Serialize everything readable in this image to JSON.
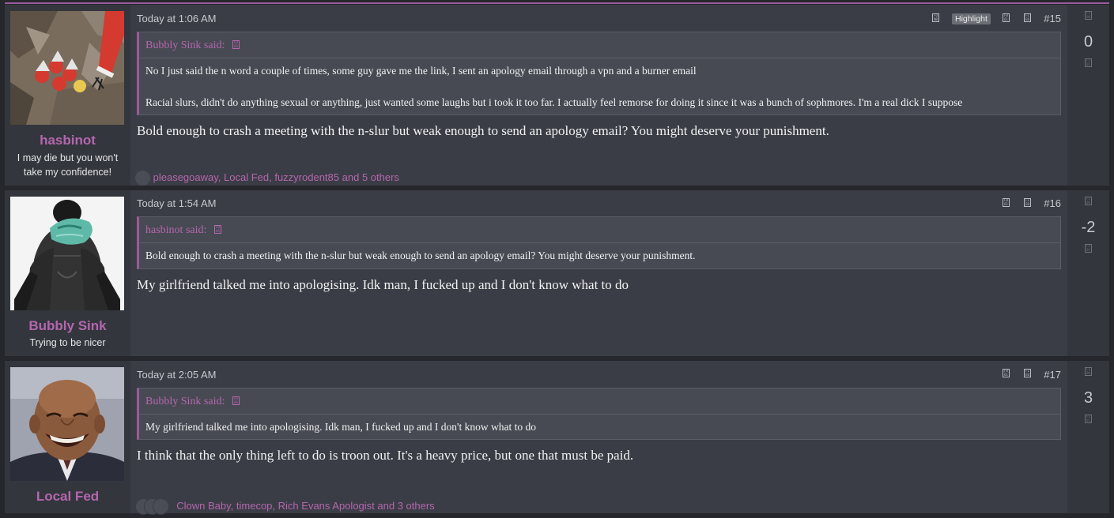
{
  "posts": [
    {
      "user": {
        "name": "hasbinot",
        "title": "I may die but you won't take my confidence!"
      },
      "date": "Today at 1:06 AM",
      "highlight_label": "Highlight",
      "number": "#15",
      "quote": {
        "author": "Bubbly Sink said:",
        "lines": [
          "No I just said the n word a couple of times, some guy gave me the link, I sent an apology email through a vpn and a burner email",
          "Racial slurs, didn't do anything sexual or anything, just wanted some laughs but i took it too far. I actually feel remorse for doing it since it was a bunch of sophmores. I'm a real dick I suppose"
        ]
      },
      "body": "Bold enough to crash a meeting with the n-slur but weak enough to send an apology email? You might deserve your punishment.",
      "reactions": {
        "users": [
          "pleasegoaway",
          "Local Fed",
          "fuzzyrodent85"
        ],
        "more": "and 5 others"
      },
      "score": "0"
    },
    {
      "user": {
        "name": "Bubbly Sink",
        "title": "Trying to be nicer"
      },
      "date": "Today at 1:54 AM",
      "number": "#16",
      "quote": {
        "author": "hasbinot said:",
        "lines": [
          "Bold enough to crash a meeting with the n-slur but weak enough to send an apology email? You might deserve your punishment."
        ]
      },
      "body": "My girlfriend talked me into apologising. Idk man, I fucked up and I don't know what to do",
      "score": "-2"
    },
    {
      "user": {
        "name": "Local Fed",
        "title": ""
      },
      "date": "Today at 2:05 AM",
      "number": "#17",
      "quote": {
        "author": "Bubbly Sink said:",
        "lines": [
          "My girlfriend talked me into apologising. Idk man, I fucked up and I don't know what to do"
        ]
      },
      "body": "I think that the only thing left to do is troon out. It's a heavy price, but one that must be paid.",
      "reactions": {
        "users": [
          "Clown Baby",
          "timecop",
          "Rich Evans Apologist"
        ],
        "more": "and 3 others"
      },
      "score": "3"
    }
  ],
  "colors": {
    "accent": "#b566ae",
    "panel": "#3a3d45",
    "sidebar": "#33363d",
    "background": "#26272c"
  }
}
